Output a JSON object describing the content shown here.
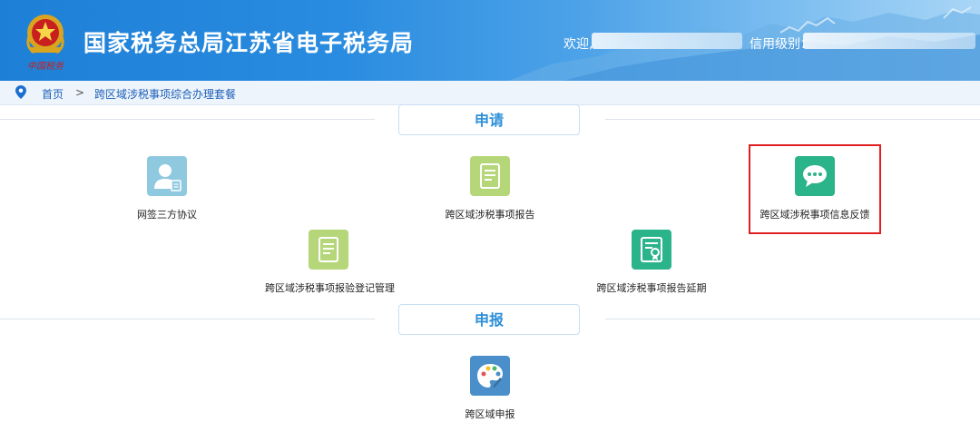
{
  "header": {
    "title": "国家税务总局江苏省电子税务局",
    "logo_caption": "中国税务",
    "welcome_label": "欢迎,",
    "credit_label": "信用级别："
  },
  "breadcrumb": {
    "home": "首页",
    "separator": ">",
    "current": "跨区域涉税事项综合办理套餐"
  },
  "sections": {
    "apply": {
      "title": "申请"
    },
    "declare": {
      "title": "申报"
    }
  },
  "tiles": [
    {
      "label": "网签三方协议",
      "icon": "user-contract-icon",
      "color": "#8fc9df"
    },
    {
      "label": "跨区域涉税事项报告",
      "icon": "document-icon",
      "color": "#b5d77a"
    },
    {
      "label": "跨区域涉税事项信息反馈",
      "icon": "chat-bubble-icon",
      "color": "#2bb38a"
    },
    {
      "label": "跨区域涉税事项报验登记管理",
      "icon": "document-icon",
      "color": "#b5d77a"
    },
    {
      "label": "跨区域涉税事项报告延期",
      "icon": "certificate-icon",
      "color": "#2bb38a"
    },
    {
      "label": "跨区域申报",
      "icon": "palette-icon",
      "color": "#4a8fc9"
    }
  ]
}
